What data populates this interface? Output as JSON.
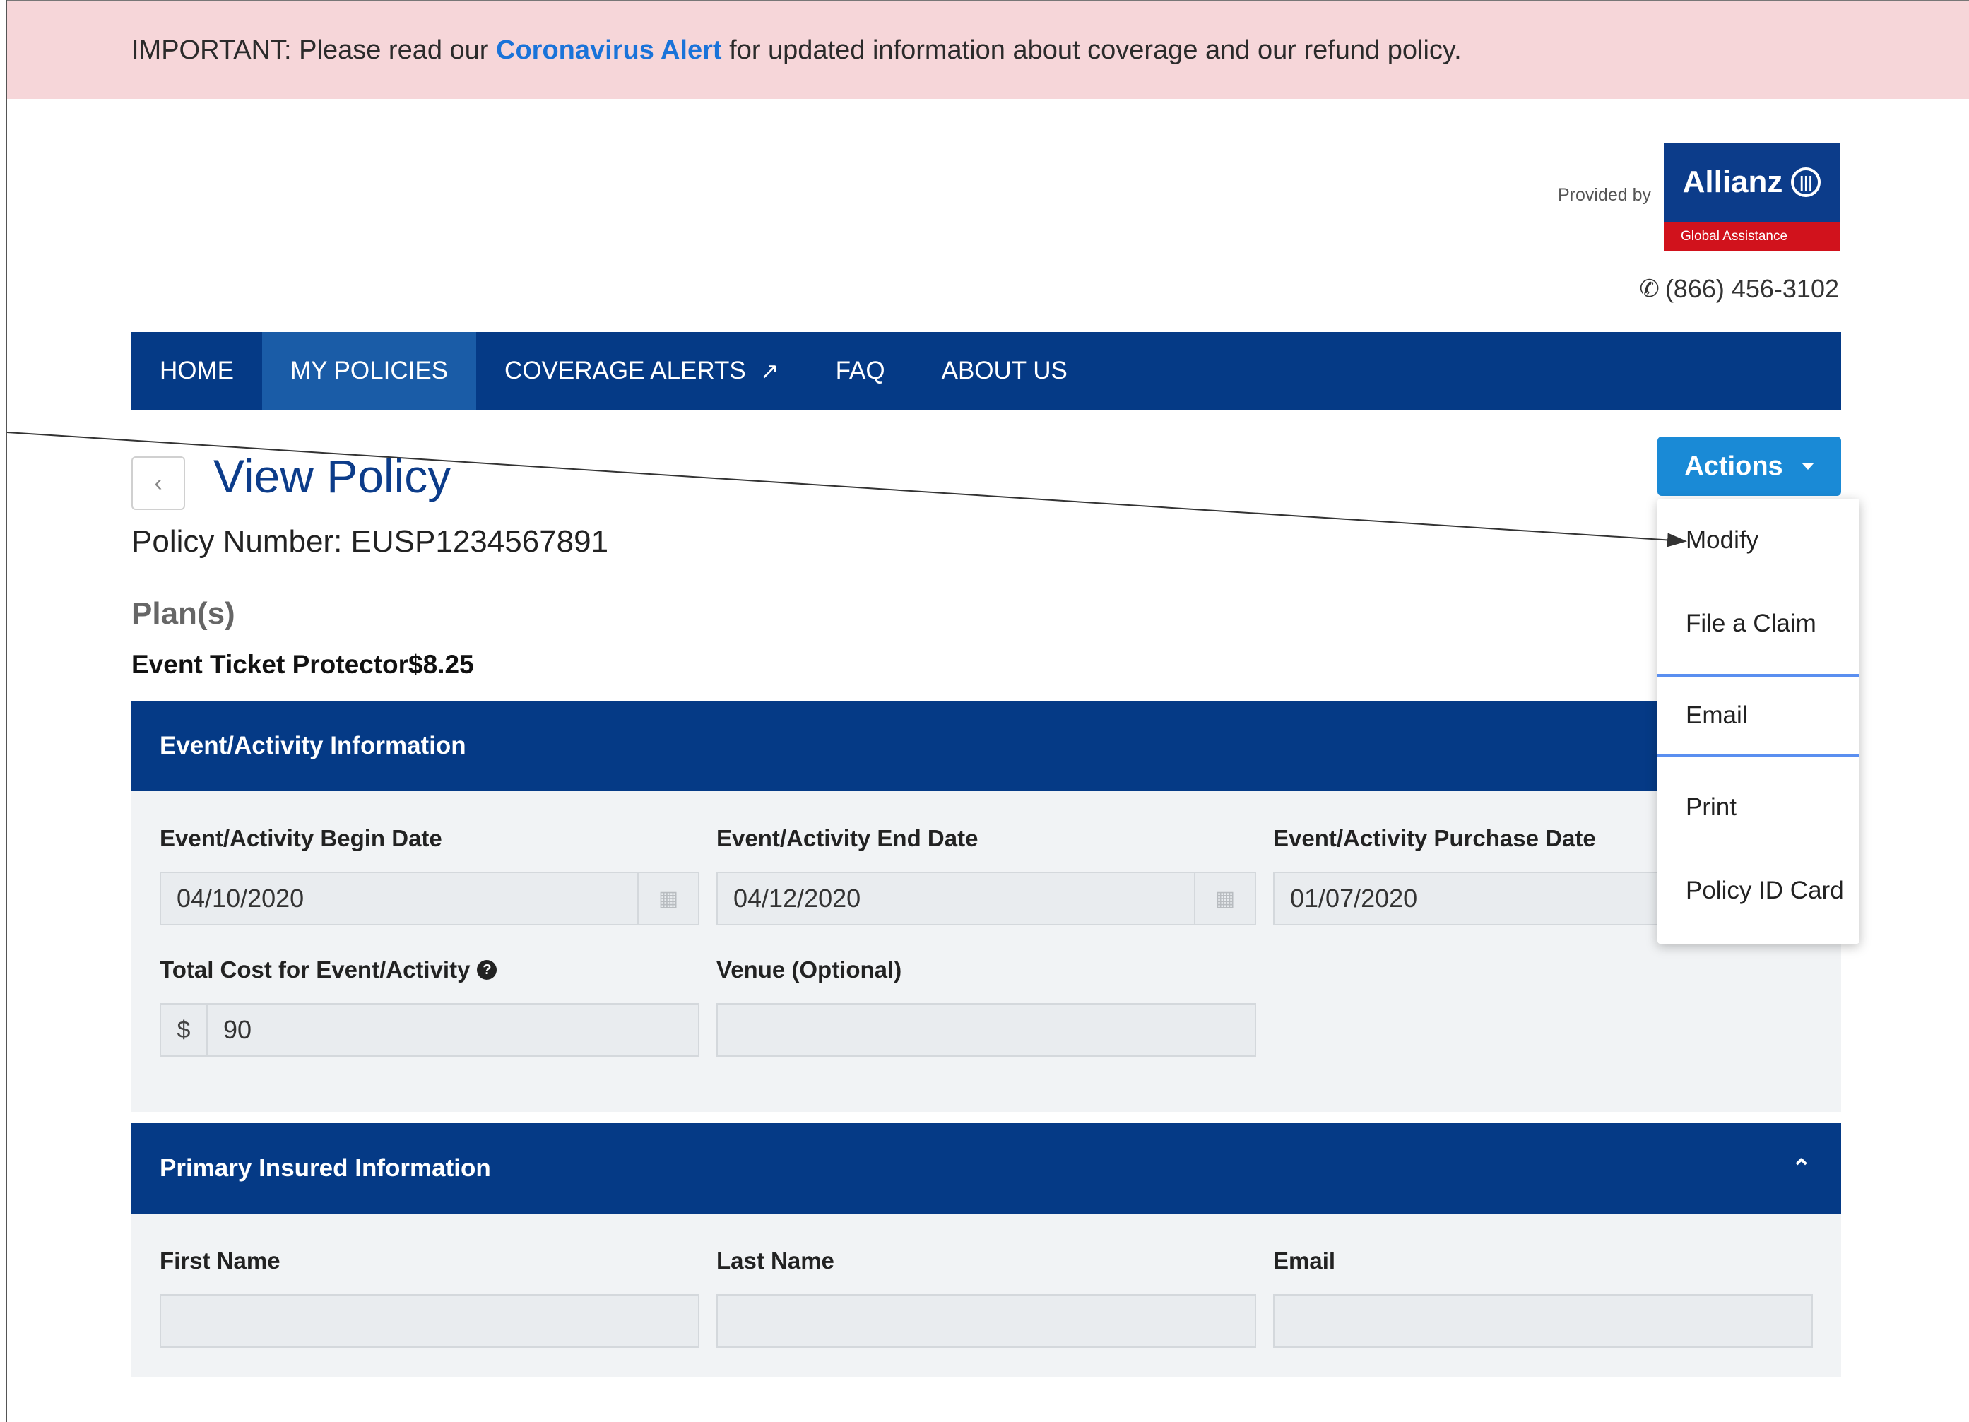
{
  "alert": {
    "prefix": "IMPORTANT: Please read our ",
    "link": "Coronavirus Alert",
    "suffix": " for updated information about coverage and our refund policy."
  },
  "branding": {
    "provided_by": "Provided by",
    "logo_name": "Allianz",
    "logo_sub": "Global Assistance",
    "brand_color": "#0c3c8a",
    "accent_red": "#d1121c"
  },
  "contact": {
    "phone": "(866) 456-3102",
    "phone_icon": "phone-icon"
  },
  "nav": {
    "items": [
      {
        "label": "HOME"
      },
      {
        "label": "MY POLICIES",
        "active": true
      },
      {
        "label": "COVERAGE ALERTS",
        "icon": "external-link-icon"
      },
      {
        "label": "FAQ"
      },
      {
        "label": "ABOUT US"
      }
    ]
  },
  "page": {
    "title": "View Policy",
    "policy_label": "Policy Number:",
    "policy_number": "EUSP1234567891",
    "plans_heading": "Plan(s)",
    "plan_line": "Event Ticket Protector$8.25"
  },
  "actions": {
    "label": "Actions",
    "menu": [
      "Modify",
      "File a Claim",
      "Email",
      "Print",
      "Policy ID Card"
    ],
    "focused_item": "Email"
  },
  "event_section": {
    "title": "Event/Activity Information",
    "begin_date": {
      "label": "Event/Activity Begin Date",
      "value": "04/10/2020"
    },
    "end_date": {
      "label": "Event/Activity End Date",
      "value": "04/12/2020"
    },
    "purchase_date": {
      "label": "Event/Activity Purchase Date",
      "value": "01/07/2020"
    },
    "total_cost": {
      "label": "Total Cost for Event/Activity",
      "prefix": "$",
      "value": "90"
    },
    "venue": {
      "label": "Venue (Optional)",
      "value": ""
    }
  },
  "insured_section": {
    "title": "Primary Insured Information",
    "first_name": {
      "label": "First Name",
      "value": ""
    },
    "last_name": {
      "label": "Last Name",
      "value": ""
    },
    "email": {
      "label": "Email",
      "value": ""
    }
  },
  "colors": {
    "alert_bg": "#f6d6d9",
    "link": "#1a73d9",
    "nav_bg": "#053a86",
    "nav_active": "#1a5ca7",
    "actions_button": "#1a8ad6"
  }
}
